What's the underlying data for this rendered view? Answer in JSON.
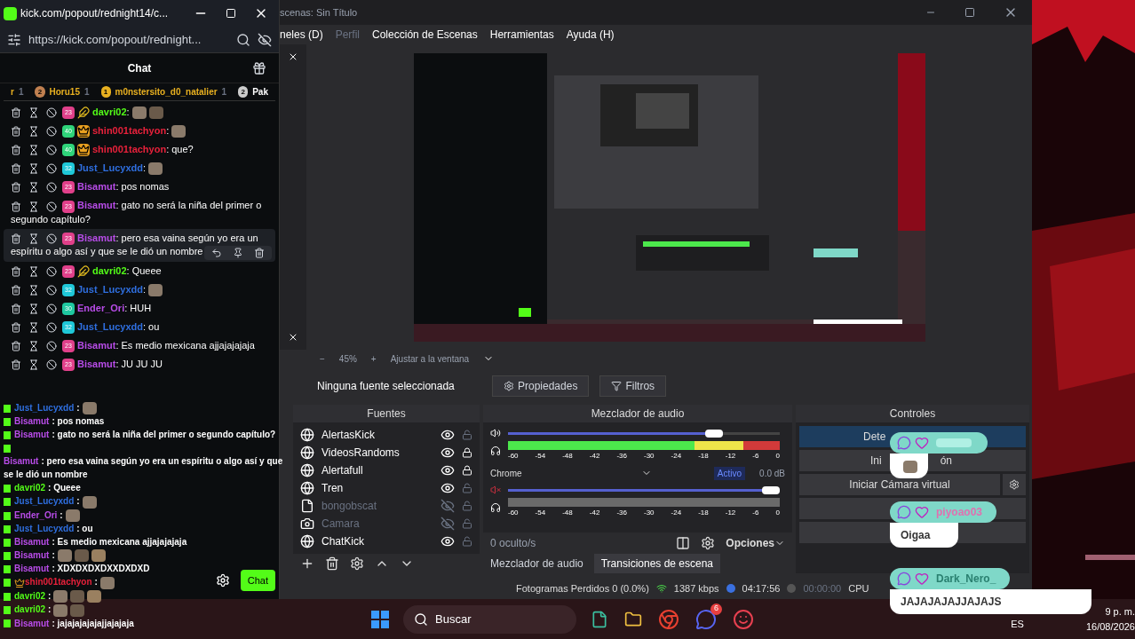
{
  "chat_window": {
    "title": "kick.com/popout/rednight14/c...",
    "url": "https://kick.com/popout/rednight...",
    "header": "Chat",
    "leaderboard": [
      {
        "name": "r",
        "count": "1"
      },
      {
        "rank": "2",
        "name": "Horu15",
        "count": "1"
      },
      {
        "rank": "1",
        "name": "m0nstersito_d0_natalier",
        "count": "1"
      },
      {
        "rank": "2",
        "name": "Pak"
      }
    ],
    "messages": [
      {
        "badge": {
          "label": "23",
          "color": "#e0408a"
        },
        "emblem": {
          "kind": "feather"
        },
        "user": "davri02",
        "color": "#53fc18",
        "text": ":",
        "hovered": false
      },
      {
        "badge": {
          "label": "40",
          "color": "#2fd47a"
        },
        "emblem": {
          "kind": "crown"
        },
        "user": "shin001tachyon",
        "color": "#e8213b",
        "text": ":",
        "hovered": false
      },
      {
        "badge": {
          "label": "40",
          "color": "#2fd47a"
        },
        "emblem": {
          "kind": "crown"
        },
        "user": "shin001tachyon",
        "color": "#e8213b",
        "text": ": que?",
        "hovered": false
      },
      {
        "badge": {
          "label": "32",
          "color": "#1fc8d8"
        },
        "user": "Just_Lucyxdd",
        "color": "#2f6fe0",
        "text": ":",
        "hovered": false
      },
      {
        "badge": {
          "label": "23",
          "color": "#e0408a"
        },
        "user": "Bisamut",
        "color": "#b84ce8",
        "text": ": pos nomas",
        "hovered": false
      },
      {
        "badge": {
          "label": "23",
          "color": "#e0408a"
        },
        "user": "Bisamut",
        "color": "#b84ce8",
        "text": ": gato no será la niña del primer o",
        "continuation": "segundo capítulo?",
        "hovered": false
      },
      {
        "badge": {
          "label": "23",
          "color": "#e0408a"
        },
        "user": "Bisamut",
        "color": "#b84ce8",
        "text": ": pero esa vaina según yo era un",
        "continuation": "espíritu o algo así y que se le dió un nombre",
        "hovered": true
      },
      {
        "badge": {
          "label": "23",
          "color": "#e0408a"
        },
        "emblem": {
          "kind": "feather"
        },
        "user": "davri02",
        "color": "#53fc18",
        "text": ": Queee",
        "hovered": false
      },
      {
        "badge": {
          "label": "32",
          "color": "#1fc8d8"
        },
        "user": "Just_Lucyxdd",
        "color": "#2f6fe0",
        "text": ":",
        "hovered": false
      },
      {
        "badge": {
          "label": "30",
          "color": "#1fc8a0"
        },
        "user": "Ender_Ori",
        "color": "#b84ce8",
        "text": ": HUH",
        "hovered": false
      },
      {
        "badge": {
          "label": "32",
          "color": "#1fc8d8"
        },
        "user": "Just_Lucyxdd",
        "color": "#2f6fe0",
        "text": ": ou",
        "hovered": false
      },
      {
        "badge": {
          "label": "23",
          "color": "#e0408a"
        },
        "user": "Bisamut",
        "color": "#b84ce8",
        "text": ": Es medio mexicana ajjajajajaja",
        "hovered": false
      },
      {
        "badge": {
          "label": "23",
          "color": "#e0408a"
        },
        "user": "Bisamut",
        "color": "#b84ce8",
        "text": ": JU JU JU",
        "hovered": false
      }
    ],
    "send_button": "Chat"
  },
  "chat_overlay": [
    {
      "user": "Just_Lucyxdd",
      "color": "#2f6fe0",
      "text": ":",
      "crown": false
    },
    {
      "user": "Bisamut",
      "color": "#b84ce8",
      "text": ": pos nomas",
      "crown": false
    },
    {
      "user": "Bisamut",
      "color": "#b84ce8",
      "text": ": gato no será la niña del primer o segundo capítulo?",
      "crown": false
    },
    {
      "user": "Bisamut",
      "color": "#b84ce8",
      "text": ": pero esa vaina según yo era un espíritu o algo así y que",
      "continuation": "se le dió un nombre",
      "crown": false
    },
    {
      "user": "davri02",
      "color": "#53fc18",
      "text": ": Queee",
      "crown": false
    },
    {
      "user": "Just_Lucyxdd",
      "color": "#2f6fe0",
      "text": ":",
      "crown": false
    },
    {
      "user": "Ender_Ori",
      "color": "#b84ce8",
      "text": ":",
      "crown": false
    },
    {
      "user": "Just_Lucyxdd",
      "color": "#2f6fe0",
      "text": ": ou",
      "crown": false
    },
    {
      "user": "Bisamut",
      "color": "#b84ce8",
      "text": ": Es medio mexicana ajjajajajaja",
      "crown": false
    },
    {
      "user": "Bisamut",
      "color": "#b84ce8",
      "text": ":",
      "crown": false
    },
    {
      "user": "Bisamut",
      "color": "#b84ce8",
      "text": ": XDXDXDXDXXDXDXD",
      "crown": false
    },
    {
      "user": "shin001tachyon",
      "color": "#e8213b",
      "text": ":",
      "crown": true
    },
    {
      "user": "davri02",
      "color": "#53fc18",
      "text": ":",
      "crown": false
    },
    {
      "user": "davri02",
      "color": "#53fc18",
      "text": ":",
      "crown": false
    },
    {
      "user": "Bisamut",
      "color": "#b84ce8",
      "text": ": jajajajajajajjajajaja",
      "crown": false
    }
  ],
  "obs": {
    "title": "scenas: Sin Título",
    "menu": [
      {
        "label": "neles (D)",
        "disabled": false
      },
      {
        "label": "Perfil",
        "disabled": true
      },
      {
        "label": "Colección de Escenas",
        "disabled": false
      },
      {
        "label": "Herramientas",
        "disabled": false
      },
      {
        "label": "Ayuda (H)",
        "disabled": false
      }
    ],
    "zoom": {
      "minus": "−",
      "value": "45%",
      "plus": "+",
      "fit": "Ajustar a la ventana"
    },
    "selection": "Ninguna fuente seleccionada",
    "properties": "Propiedades",
    "filters": "Filtros",
    "sources_title": "Fuentes",
    "sources": [
      {
        "name": "AlertasKick",
        "kind": "browser",
        "visible": true,
        "locked": false
      },
      {
        "name": "VideosRandoms",
        "kind": "browser",
        "visible": true,
        "locked": true
      },
      {
        "name": "Alertafull",
        "kind": "browser",
        "visible": true,
        "locked": true
      },
      {
        "name": "Tren",
        "kind": "browser",
        "visible": true,
        "locked": false
      },
      {
        "name": "bongobscat",
        "kind": "file",
        "visible": false,
        "locked": false
      },
      {
        "name": "Camara",
        "kind": "camera",
        "visible": false,
        "locked": false
      },
      {
        "name": "ChatKick",
        "kind": "browser",
        "visible": true,
        "locked": false
      }
    ],
    "mixer_title": "Mezclador de audio",
    "channels": [
      {
        "muted": false,
        "level": 0.79,
        "scale": [
          "-60",
          "-54",
          "-48",
          "-42",
          "-36",
          "-30",
          "-24",
          "-18",
          "-12",
          "-6",
          "0"
        ]
      },
      {
        "name": "Chrome",
        "status": "Activo",
        "reading": "0.0 dB",
        "muted": true,
        "level": 1,
        "scale": [
          "-60",
          "-54",
          "-48",
          "-42",
          "-36",
          "-30",
          "-24",
          "-18",
          "-12",
          "-6",
          "0"
        ]
      }
    ],
    "hidden_count": "0 oculto/s",
    "options": "Opciones",
    "dock_tabs": [
      {
        "label": "Mezclador de audio",
        "selected": false
      },
      {
        "label": "Transiciones de escena",
        "selected": true
      }
    ],
    "controls_title": "Controles",
    "controls": [
      {
        "parts": [
          "Dete"
        ],
        "active": true,
        "gear": false
      },
      {
        "parts": [
          "Ini",
          "ón"
        ],
        "active": false,
        "gear": false
      },
      {
        "parts": [
          "Iniciar Cámara virtual"
        ],
        "active": false,
        "gear": true
      },
      {
        "active": false,
        "gear": false
      },
      {
        "active": false,
        "gear": false
      }
    ],
    "status": {
      "dropped": "Fotogramas Perdidos 0 (0.0%)",
      "bitrate": "1387 kbps",
      "stream_time": "04:17:56",
      "rec_time": "00:00:00",
      "cpu": "CPU"
    }
  },
  "alerts": [
    {
      "color": "#b0f0e4"
    },
    {
      "name": "piyoao03",
      "color": "#e070b0",
      "text": "Oigaa"
    },
    {
      "name": "Dark_Nero_",
      "color": "#2a8070",
      "text": "JAJAJAJAJJAJAJS"
    }
  ],
  "taskbar": {
    "search": "Buscar",
    "badge": "6",
    "language": "ES",
    "time": "9 p. m.",
    "date": "16/08/2026"
  }
}
